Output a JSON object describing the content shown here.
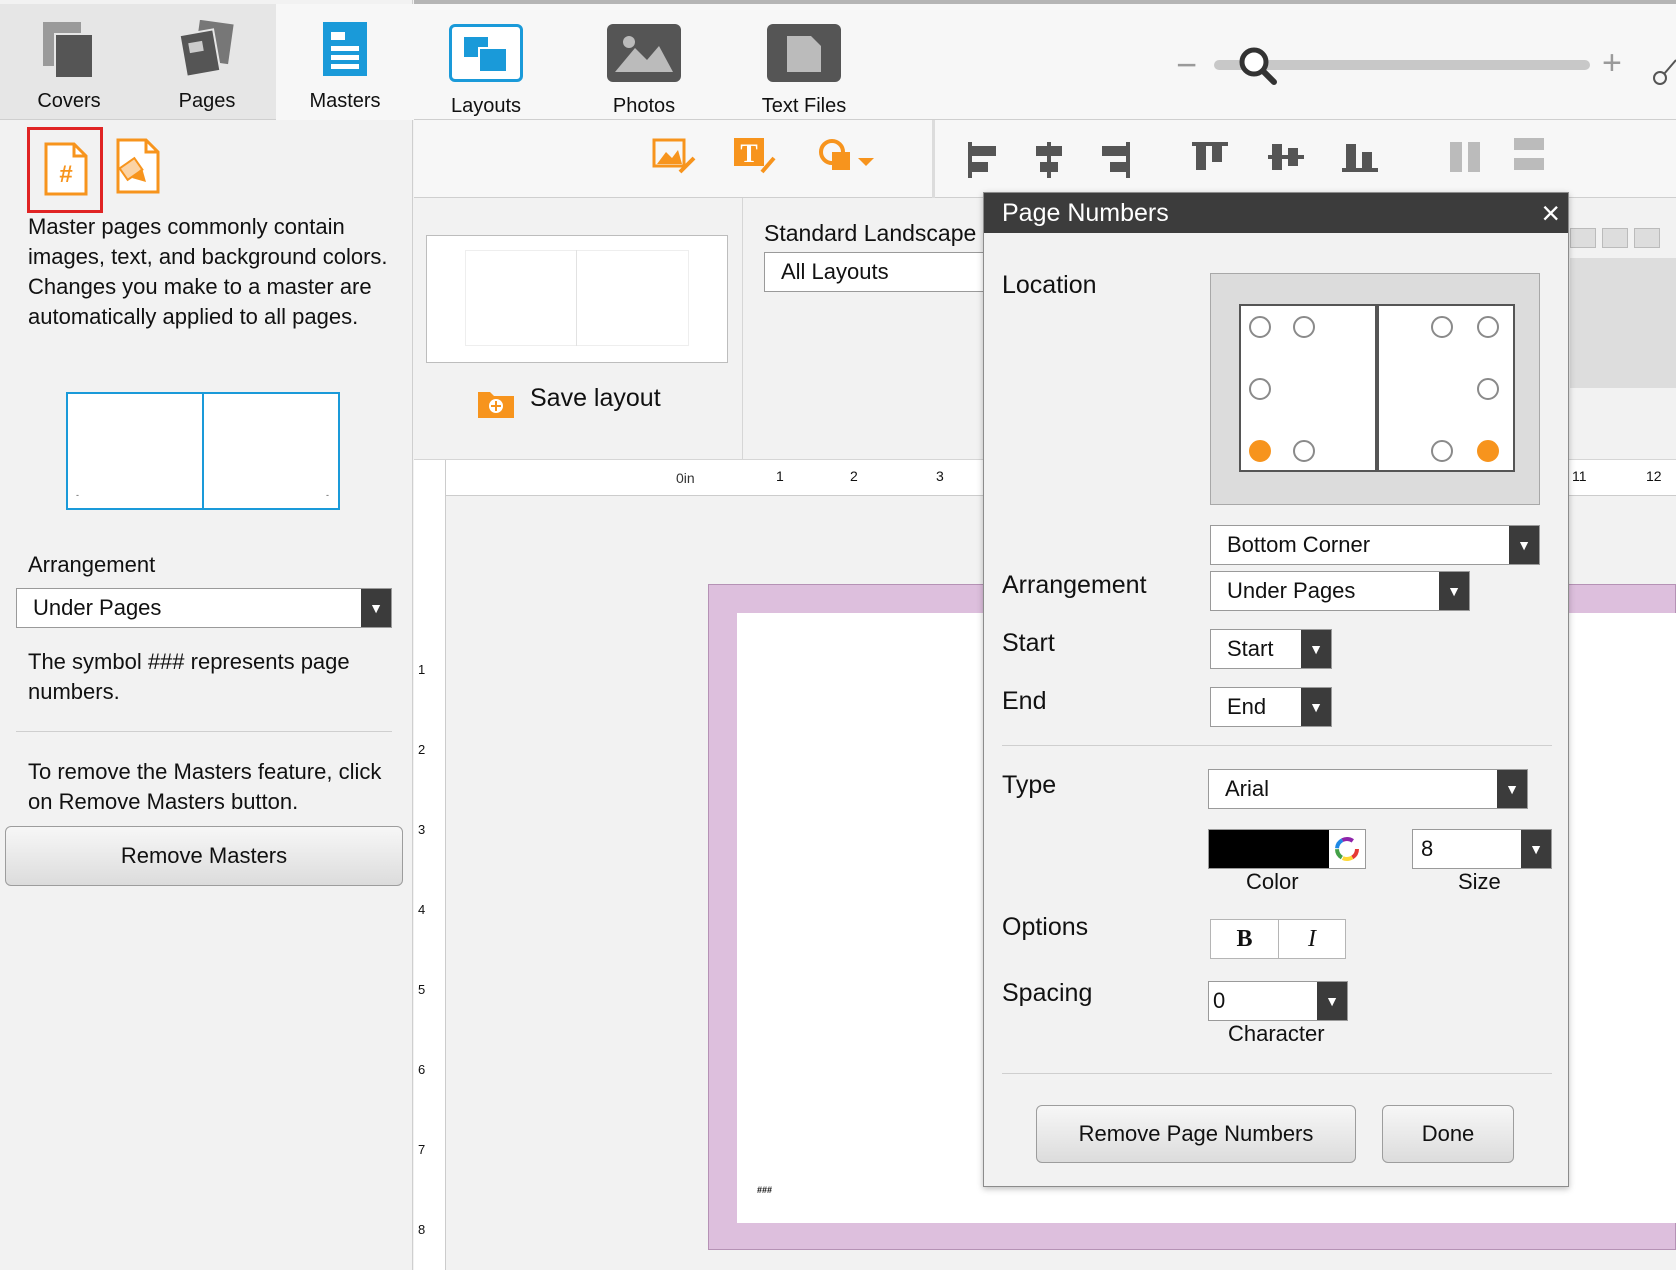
{
  "left_panel": {
    "tabs": [
      {
        "label": "Covers"
      },
      {
        "label": "Pages"
      },
      {
        "label": "Masters"
      }
    ],
    "description": "Master pages commonly contain images, text, and background colors. Changes you make to a master are automatically applied to all pages.",
    "preview_marks": [
      "-",
      "-"
    ],
    "arrangement_label": "Arrangement",
    "arrangement_value": "Under Pages",
    "symbol_note": "The symbol ### represents page numbers.",
    "remove_note": "To remove the Masters feature, click on Remove Masters button.",
    "remove_masters_button": "Remove Masters"
  },
  "toolbar": {
    "tools": [
      {
        "label": "Layouts"
      },
      {
        "label": "Photos"
      },
      {
        "label": "Text Files"
      }
    ],
    "zoom_minus": "−",
    "zoom_plus": "+"
  },
  "layout_strip": {
    "layout_name": "Standard Landscape",
    "layout_filter": "All Layouts",
    "save_layout": "Save layout"
  },
  "ruler": {
    "origin": "0in",
    "h_ticks": [
      "1",
      "2",
      "3",
      "11",
      "12"
    ],
    "v_ticks": [
      "1",
      "2",
      "3",
      "4",
      "5",
      "6",
      "7",
      "8"
    ]
  },
  "canvas": {
    "page_number_marker": "###"
  },
  "dialog": {
    "title": "Page Numbers",
    "close": "×",
    "location_label": "Location",
    "location_value": "Bottom Corner",
    "arrangement_label": "Arrangement",
    "arrangement_value": "Under Pages",
    "start_label": "Start",
    "start_value": "Start",
    "end_label": "End",
    "end_value": "End",
    "type_label": "Type",
    "font_value": "Arial",
    "color_value": "#000000",
    "color_caption": "Color",
    "size_value": "8",
    "size_caption": "Size",
    "options_label": "Options",
    "bold": "B",
    "italic": "I",
    "spacing_label": "Spacing",
    "spacing_value": "0",
    "spacing_caption": "Character",
    "remove_button": "Remove Page Numbers",
    "done_button": "Done",
    "selected_location": "bottom-outer",
    "accent_color": "#f7941d"
  }
}
